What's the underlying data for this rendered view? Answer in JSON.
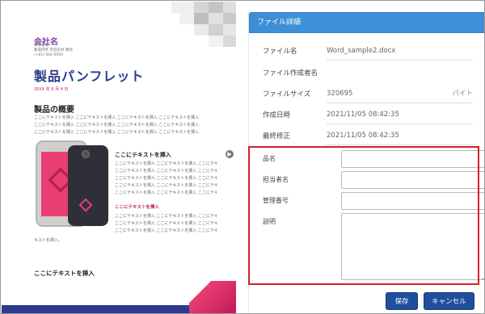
{
  "document": {
    "company": "会社名",
    "address_lines": [
      "郵便番号",
      "都道府県 市区町村 番地",
      "(+81) 000-0000"
    ],
    "title": "製品パンフレット",
    "date": "20XX 年 9 月 4 日",
    "section_title": "製品の概要",
    "body_text": "ここにテキストを挿入 ここにテキストを挿入 ここにテキストを挿入 ここにテキストを挿入",
    "sub_title": "ここにテキストを挿入",
    "side_text": "ここにテキストを挿入 ここにテキストを挿入 ここにテキストを",
    "pink_sub": "ここにテキストを挿入",
    "tail_text": "キストを挿入。",
    "bottom_title": "ここにテキストを挿入"
  },
  "panel": {
    "header": "ファイル詳細",
    "info": [
      {
        "label": "ファイル名",
        "value": "Word_sample2.docx",
        "unit": ""
      },
      {
        "label": "ファイル作成者名",
        "value": "",
        "unit": ""
      },
      {
        "label": "ファイルサイズ",
        "value": "320695",
        "unit": "バイト"
      },
      {
        "label": "作成日時",
        "value": "2021/11/05 08:42:35",
        "unit": ""
      },
      {
        "label": "最終修正",
        "value": "2021/11/05 08:42:35",
        "unit": ""
      }
    ],
    "form": {
      "product_name_label": "品名",
      "person_label": "担当者名",
      "manage_no_label": "管理番号",
      "description_label": "説明",
      "product_name_value": "",
      "person_value": "",
      "manage_no_value": "",
      "description_value": ""
    },
    "buttons": {
      "save": "保存",
      "cancel": "キャンセル"
    }
  },
  "colors": {
    "header_blue": "#3d8fd6",
    "button_blue": "#1f4f9c",
    "highlight_red": "#d4202a",
    "doc_title_navy": "#2b3a8f",
    "accent_pink": "#e83e72"
  }
}
